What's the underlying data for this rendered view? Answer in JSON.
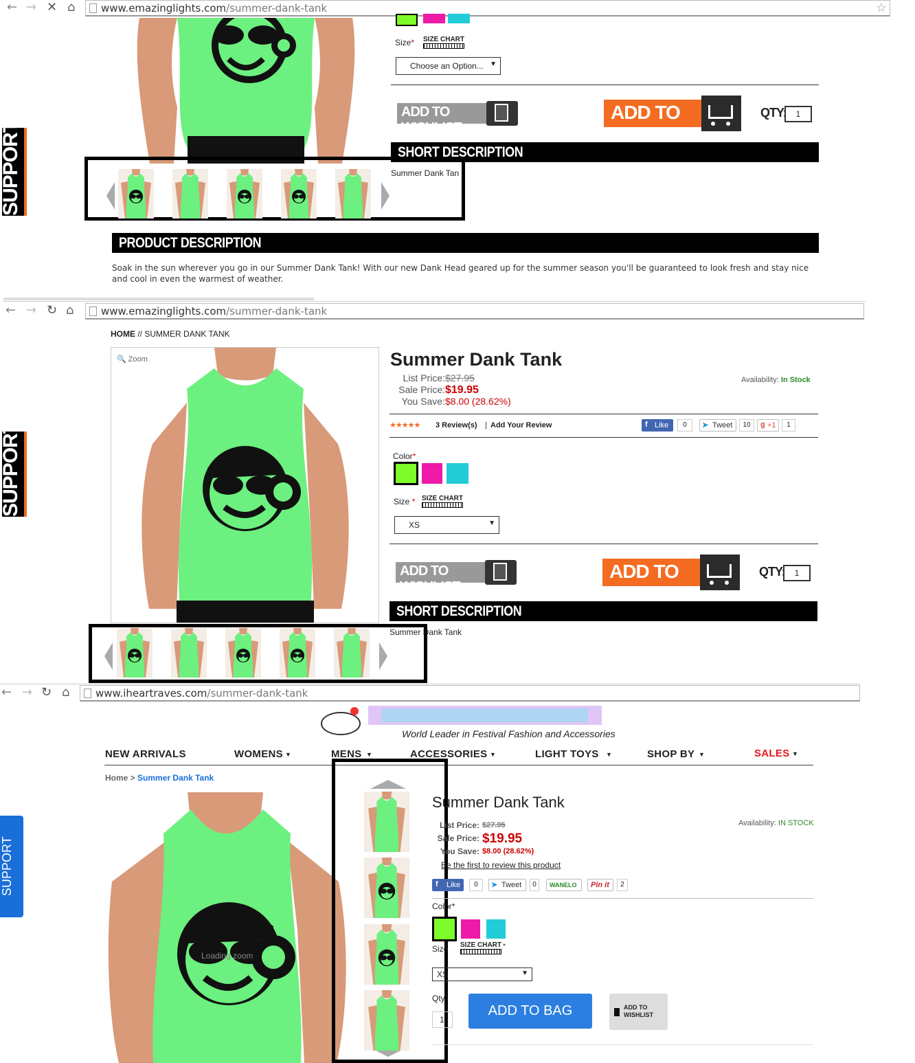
{
  "browser1": {
    "domain": "www.emazinglights.com",
    "path": "/summer-dank-tank"
  },
  "browser2": {
    "domain": "www.emazinglights.com",
    "path": "/summer-dank-tank"
  },
  "browser3": {
    "domain": "www.iheartraves.com",
    "path": "/summer-dank-tank"
  },
  "support_label_el": "SUPPORT",
  "support_label_ih": "SUPPORT",
  "el1": {
    "size_label": "Size",
    "required_mark": "*",
    "size_chart": "SIZE CHART",
    "size_select": "Choose an Option...",
    "wishlist": "ADD TO WISHLIST",
    "cart": "ADD TO CART",
    "qty_label": "QTY:",
    "qty": "1",
    "short_desc_heading": "SHORT DESCRIPTION",
    "short_desc": "Summer Dank Tan",
    "product_desc_heading": "PRODUCT DESCRIPTION",
    "product_desc": "Soak in the sun wherever you go in our Summer Dank Tank! With our new Dank Head geared up for the summer season you'll be guaranteed to look fresh and stay nice and cool in even the warmest of weather."
  },
  "el2": {
    "breadcrumb_home": "HOME",
    "breadcrumb_sep": "//",
    "breadcrumb_current": "SUMMER DANK TANK",
    "zoom": "Zoom",
    "title": "Summer Dank Tank",
    "list_price_label": "List Price:",
    "list_price": "$27.95",
    "sale_price_label": "Sale Price:",
    "sale_price": "$19.95",
    "you_save_label": "You Save:",
    "you_save": "$8.00 (28.62%)",
    "availability_label": "Availability:",
    "availability": "In Stock",
    "reviews": "3 Review(s)",
    "review_sep": "|",
    "add_review": "Add Your Review",
    "fb_like": "Like",
    "fb_count": "0",
    "tweet": "Tweet",
    "tweet_count": "10",
    "gplus": "+1",
    "gplus_count": "1",
    "color_label": "Color",
    "required_mark": "*",
    "size_label": "Size",
    "size_chart": "SIZE CHART",
    "size_select": "XS",
    "wishlist": "ADD TO WISHLIST",
    "cart": "ADD TO CART",
    "qty_label": "QTY:",
    "qty": "1",
    "short_desc_heading": "SHORT DESCRIPTION",
    "short_desc": "Summer Dank Tank"
  },
  "ih": {
    "tagline": "World Leader in Festival Fashion and Accessories",
    "nav": [
      "NEW ARRIVALS",
      "WOMENS",
      "MENS",
      "ACCESSORIES",
      "LIGHT TOYS",
      "SHOP BY",
      "SALES"
    ],
    "breadcrumb_home": "Home",
    "breadcrumb_sep": ">",
    "breadcrumb_current": "Summer Dank Tank",
    "loading_zoom": "Loading zoom",
    "title": "Summer Dank Tank",
    "list_price_label": "List Price:",
    "list_price": "$27.95",
    "sale_price_label": "Sale Price:",
    "sale_price": "$19.95",
    "you_save_label": "You Save:",
    "you_save": "$8.00 (28.62%)",
    "availability_label": "Availability:",
    "availability": "IN STOCK",
    "review_link": "Be the first to review this product",
    "fb_like": "Like",
    "fb_count": "0",
    "tweet": "Tweet",
    "tweet_count": "0",
    "wanelo": "WANELO",
    "pinit": "Pin it",
    "pin_count": "2",
    "color_label": "Color",
    "size_label": "Size",
    "size_chart": "SIZE CHART",
    "size_select": "XS",
    "qty_label": "Qty",
    "qty": "1",
    "add_to_bag": "ADD TO BAG",
    "wishlist": "ADD TO WISHLIST"
  },
  "colors": {
    "green": "#7dfc2a",
    "pink": "#ee1aa8",
    "cyan": "#21ccd6",
    "el_orange": "#f36c21",
    "sale_red": "#cc0000",
    "ih_blue": "#1a6ed8",
    "stock_green": "#2a8a2a"
  }
}
